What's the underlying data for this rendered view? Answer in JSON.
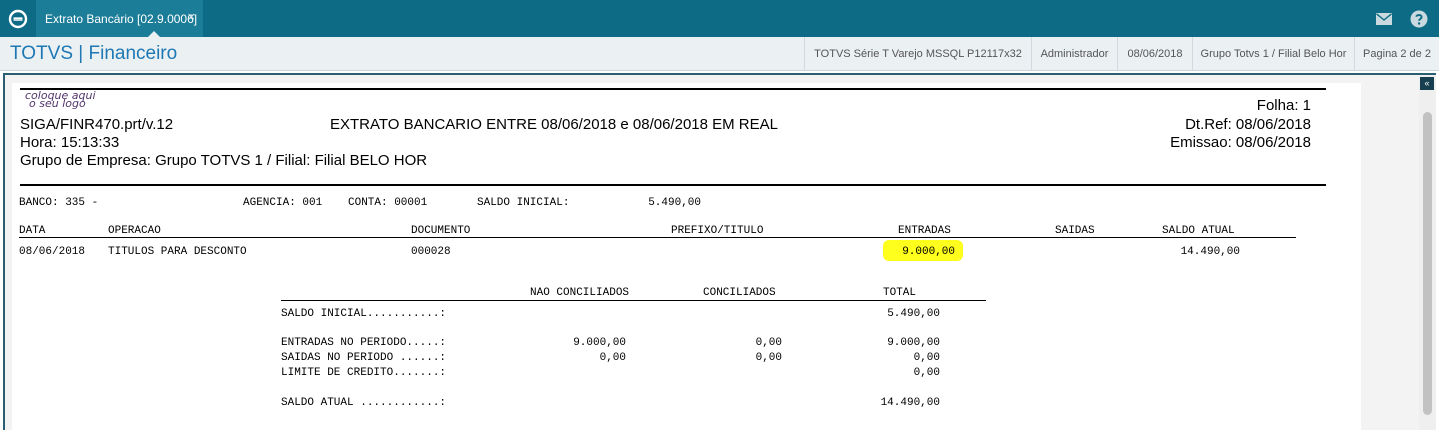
{
  "window": {
    "tab_title": "Extrato Bancário [02.9.0006]",
    "tab_close": "×",
    "icons": {
      "app": "totvs-logo-icon",
      "mail": "mail-icon",
      "help": "help-icon"
    }
  },
  "titlebar": {
    "app_title": "TOTVS | Financeiro",
    "environment": "TOTVS Série T Varejo MSSQL P12117x32",
    "user": "Administrador",
    "date": "08/06/2018",
    "group": "Grupo Totvs 1 / Filial Belo Hor",
    "pagination": "Pagina 2 de 2"
  },
  "scrollbar": {
    "collapse_glyph": "«"
  },
  "colors": {
    "topbar": "#0e6b86",
    "accent": "#1e78b4",
    "highlight": "#ffff1e"
  },
  "report": {
    "logo_line1": "coloque aqui",
    "logo_line2": "o seu logo",
    "folha": "Folha:   1",
    "program": "SIGA/FINR470.prt/v.12",
    "title": "EXTRATO BANCARIO ENTRE  08/06/2018 e 08/06/2018  EM  REAL",
    "dt_ref": "Dt.Ref: 08/06/2018",
    "hora": "Hora: 15:13:33",
    "emissao": "Emissao: 08/06/2018",
    "grupo": "Grupo de Empresa: Grupo TOTVS 1 / Filial: Filial BELO HOR",
    "account": {
      "banco": "BANCO: 335 -",
      "agencia": "AGENCIA:  001",
      "conta": "CONTA:  00001",
      "saldo_inicial_label": "SALDO INICIAL:",
      "saldo_inicial_value": "5.490,00"
    },
    "columns": {
      "data": "DATA",
      "operacao": "OPERACAO",
      "documento": "DOCUMENTO",
      "prefixo": "PREFIXO/TITULO",
      "entradas": "ENTRADAS",
      "saidas": "SAIDAS",
      "saldo_atual": "SALDO ATUAL"
    },
    "row": {
      "data": "08/06/2018",
      "operacao": "TITULOS PARA DESCONTO",
      "documento": "000028",
      "entradas": "9.000,00",
      "saldo": "14.490,00"
    },
    "summary": {
      "headers": {
        "nao_conciliados": "NAO CONCILIADOS",
        "conciliados": "CONCILIADOS",
        "total": "TOTAL"
      },
      "saldo_inicial": {
        "label": "SALDO INICIAL...........:",
        "total": "5.490,00"
      },
      "entradas": {
        "label": "ENTRADAS NO PERIODO.....:",
        "nao": "9.000,00",
        "conc": "0,00",
        "total": "9.000,00"
      },
      "saidas": {
        "label": "SAIDAS NO PERIODO ......:",
        "nao": "0,00",
        "conc": "0,00",
        "total": "0,00"
      },
      "limite": {
        "label": "LIMITE DE CREDITO.......:",
        "total": "0,00"
      },
      "saldo_atual": {
        "label": "SALDO ATUAL ............:",
        "total": "14.490,00"
      }
    }
  }
}
